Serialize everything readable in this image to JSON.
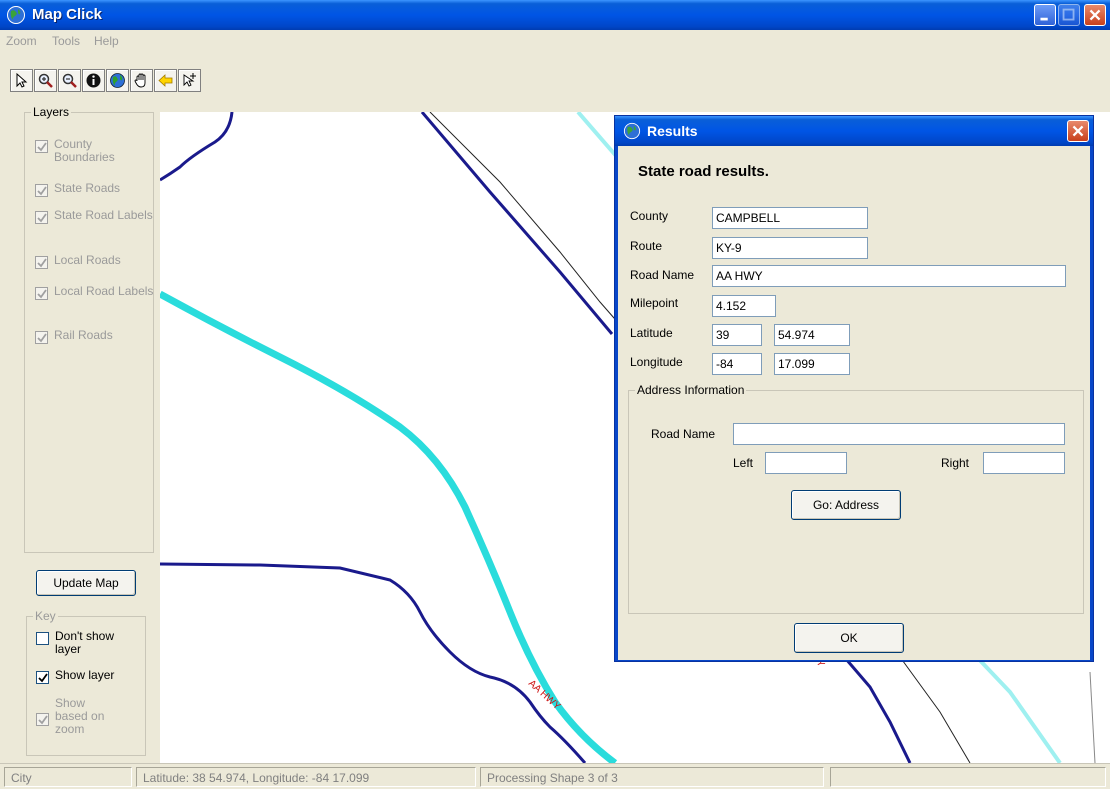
{
  "window": {
    "title": "Map Click"
  },
  "menu": [
    "Zoom",
    "Tools",
    "Help"
  ],
  "toolbar": [
    {
      "icon": "pointer-arrow-icon",
      "tip": "Select"
    },
    {
      "icon": "zoom-in-icon",
      "tip": "Zoom In"
    },
    {
      "icon": "zoom-out-icon",
      "tip": "Zoom Out"
    },
    {
      "icon": "info-icon",
      "tip": "Identify"
    },
    {
      "icon": "globe-icon",
      "tip": "Full Extent"
    },
    {
      "icon": "hand-pan-icon",
      "tip": "Pan"
    },
    {
      "icon": "back-arrow-icon",
      "tip": "Previous Extent"
    },
    {
      "icon": "measure-icon",
      "tip": "Measure"
    }
  ],
  "layers": {
    "title": "Layers",
    "items": [
      {
        "label": "County Boundaries",
        "checked": true
      },
      {
        "label": "State Roads",
        "checked": true
      },
      {
        "label": "State Road Labels",
        "checked": true
      },
      {
        "label": "Local Roads",
        "checked": true
      },
      {
        "label": "Local Road Labels",
        "checked": true
      },
      {
        "label": "Rail Roads",
        "checked": true
      }
    ]
  },
  "update_button": "Update Map",
  "key": {
    "title": "Key",
    "dont_show": "Don't show layer",
    "show": "Show layer",
    "show_zoom": "Show based on zoom"
  },
  "map": {
    "road_label_1": "AA HWY",
    "road_label_2": "AA HWY",
    "colors": {
      "state_road": "#1a1a8c",
      "local_road": "#2adcdc",
      "light_road": "#9ff0f0",
      "label": "#cc1111"
    }
  },
  "status": {
    "layer": "City",
    "coords": "Latitude: 38 54.974, Longitude: -84 17.099",
    "progress": "Processing Shape 3 of 3",
    "extra": ""
  },
  "results": {
    "title": "Results",
    "heading": "State road results.",
    "county_label": "County",
    "county": "CAMPBELL",
    "route_label": "Route",
    "route": "KY-9",
    "road_name_label": "Road Name",
    "road_name": "AA HWY",
    "milepoint_label": "Milepoint",
    "milepoint": "4.152",
    "latitude_label": "Latitude",
    "lat_deg": "39",
    "lat_min": "54.974",
    "longitude_label": "Longitude",
    "lon_deg": "-84",
    "lon_min": "17.099",
    "address_title": "Address Information",
    "addr_road_label": "Road Name",
    "addr_road": "",
    "left_label": "Left",
    "left": "",
    "right_label": "Right",
    "right": "",
    "go_button": "Go: Address",
    "ok_button": "OK"
  }
}
